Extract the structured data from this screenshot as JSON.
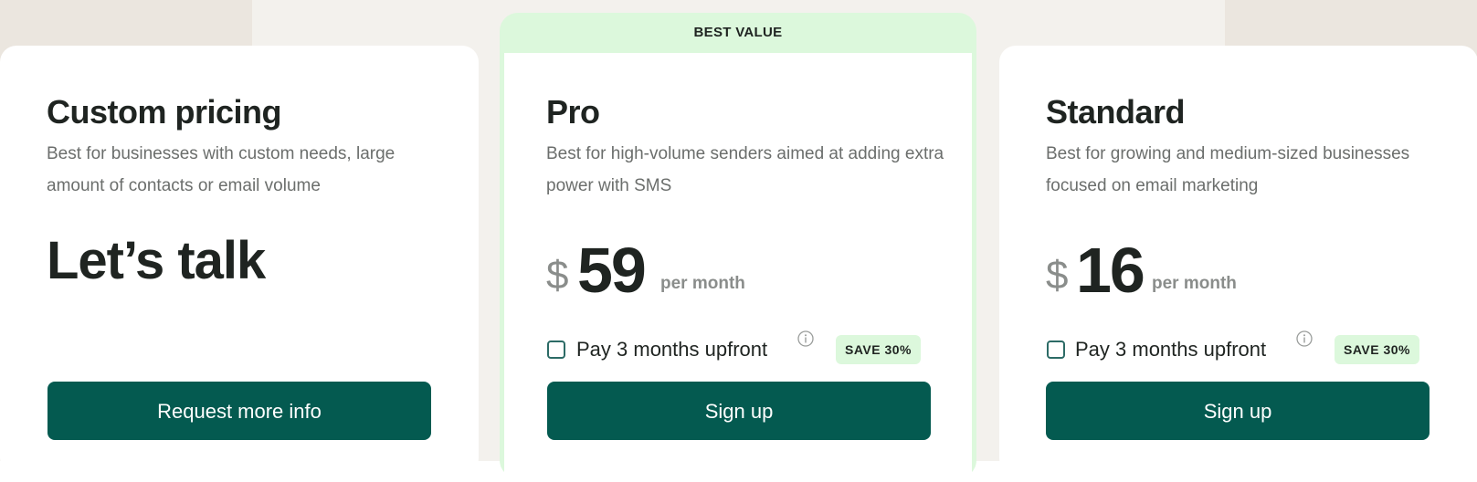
{
  "colors": {
    "primary": "#045a50",
    "accent_green": "#dcf8dc",
    "heading": "#1f2421",
    "muted": "#6b6e6c"
  },
  "plans": {
    "custom": {
      "title": "Custom pricing",
      "description": "Best for businesses with custom needs, large amount of contacts or email volume",
      "price_text": "Let’s talk",
      "cta": "Request more info"
    },
    "pro": {
      "badge": "BEST VALUE",
      "title": "Pro",
      "description": "Best for high-volume senders aimed at adding extra power with SMS",
      "currency": "$",
      "amount": "59",
      "period": "per month",
      "upfront_label": "Pay 3 months upfront",
      "upfront_checked": false,
      "save_badge": "SAVE 30%",
      "cta": "Sign up"
    },
    "standard": {
      "title": "Standard",
      "description": "Best for growing and medium-sized businesses focused on email marketing",
      "currency": "$",
      "amount": "16",
      "period": "per month",
      "upfront_label": "Pay 3 months upfront",
      "upfront_checked": false,
      "save_badge": "SAVE 30%",
      "cta": "Sign up"
    }
  },
  "icons": {
    "info": "info-circle-icon"
  }
}
